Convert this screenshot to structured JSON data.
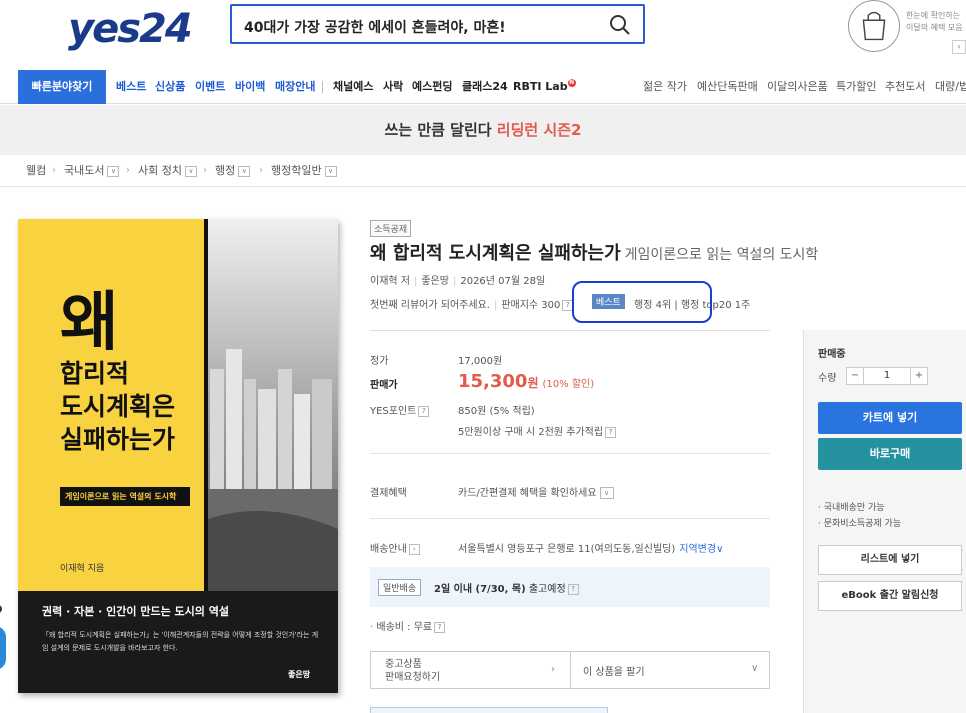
{
  "header": {
    "logo": "yes24",
    "search_value": "40대가 가장 공감한 에세이 흔들려야, 마흔!",
    "cart_note": "한눈에 확인하는 이달의 혜택 모음",
    "cart_arrow": "‹"
  },
  "nav": {
    "quick": "빠른분야찾기",
    "blue_items": [
      "베스트",
      "신상품",
      "이벤트",
      "바이백",
      "매장안내"
    ],
    "dark_items": [
      "채널예스",
      "사락",
      "예스펀딩",
      "클래스24",
      "RBTI Lab"
    ],
    "rbti_badge": "N",
    "right_items": [
      "젊은 작가",
      "예산단독판매",
      "이달의사은품",
      "특가할인",
      "추천도서",
      "대량/법"
    ]
  },
  "banner": {
    "text": "쓰는 만큼 달린다 ",
    "highlight": "리딩런 시즌2"
  },
  "breadcrumb": [
    "웰컴",
    "국내도서",
    "사회 정치",
    "행정",
    "행정학일반"
  ],
  "cover": {
    "title_big": "왜",
    "title_lines": "합리적\n도시계획은\n실패하는가",
    "subtitle": "게임이론으로 읽는 역설의 도시학",
    "author": "이재혁 지음",
    "tagline": "권력 · 자본 · 인간이 만드는 도시의 역설",
    "desc": "「왜 합리적 도시계획은 실패하는가」는 '이해관계자들의 전략을 어떻게 조정할 것인가'라는 게임 설계의 문제로 도시개발을 바라보고자 한다.",
    "publisher": "좋은땅"
  },
  "product": {
    "tag": "소득공제",
    "title": "왜 합리적 도시계획은 실패하는가",
    "subtitle": "게임이론으로 읽는 역설의 도시학",
    "author": "이재혁 저",
    "publisher": "좋은땅",
    "date": "2026년 07월 28일",
    "review_prompt": "첫번째 리뷰어가 되어주세요.",
    "sales_index": "판매지수 300",
    "best_badge": "베스트",
    "rank_text": "행정 4위 | 행정 top20 1주"
  },
  "price": {
    "list_label": "정가",
    "list_value": "17,000원",
    "sale_label": "판매가",
    "sale_value": "15,300",
    "sale_unit": "원",
    "discount": "(10% 할인)",
    "point_label": "YES포인트",
    "point_value": "850원 (5% 적립)",
    "point_extra": "5만원이상 구매 시 2천원 추가적립"
  },
  "payment": {
    "label": "결제혜택",
    "value": "카드/간편결제 혜택을 확인하세요"
  },
  "shipping": {
    "label": "배송안내",
    "address": "서울특별시 영등포구 은행로 11(여의도동,일신빌딩)",
    "region_change": "지역변경",
    "badge": "일반배송",
    "eta_strong": "2일 이내 (7/30, 목)",
    "eta_rest": " 출고예정",
    "fee": "배송비 : 무료"
  },
  "used": {
    "left": "중고상품\n판매요청하기",
    "right": "이 상품을 팔기"
  },
  "buybox": {
    "status": "판매중",
    "qty_label": "수량",
    "qty_value": "1",
    "cart": "카트에 넣기",
    "buy": "바로구매",
    "note1": "· 국내배송만 가능",
    "note2": "· 문화비소득공제 가능",
    "list": "리스트에 넣기",
    "ebook": "eBook 출간 알림신청"
  }
}
